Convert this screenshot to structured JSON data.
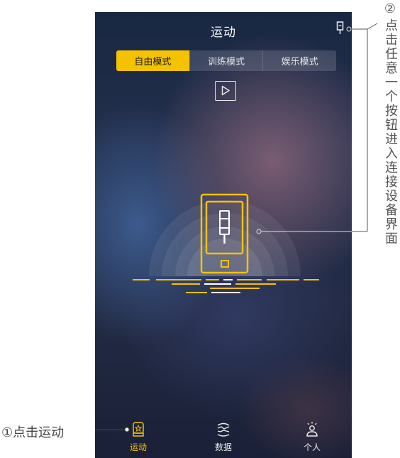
{
  "header": {
    "title": "运动"
  },
  "mode_tabs": [
    {
      "label": "自由模式",
      "active": true
    },
    {
      "label": "训练模式",
      "active": false
    },
    {
      "label": "娱乐模式",
      "active": false
    }
  ],
  "bottom_nav": [
    {
      "label": "运动",
      "icon": "boxing-glove-icon",
      "active": true
    },
    {
      "label": "数据",
      "icon": "stats-icon",
      "active": false
    },
    {
      "label": "个人",
      "icon": "person-icon",
      "active": false
    }
  ],
  "annotations": {
    "step1_number": "①",
    "step1_text": "点击运动",
    "step2_number": "②",
    "step2_text": "点击任意一个按钮进入连接设备界面"
  },
  "colors": {
    "accent": "#f5c200",
    "background": "#1e2a46",
    "text": "#f4f4f4"
  }
}
